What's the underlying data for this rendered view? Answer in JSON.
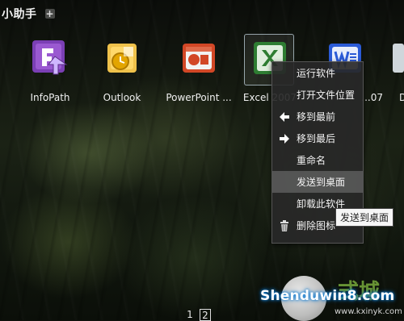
{
  "app": {
    "title": "小助手"
  },
  "tiles": [
    {
      "label": "InfoPath",
      "icon": "infopath-icon"
    },
    {
      "label": "Outlook",
      "icon": "outlook-icon"
    },
    {
      "label": "PowerPoint ...",
      "icon": "powerpoint-icon"
    },
    {
      "label": "Excel 2007",
      "icon": "excel-icon"
    },
    {
      "label": "...07",
      "icon": "word-icon"
    },
    {
      "label": "D",
      "icon": "partial-icon"
    }
  ],
  "context_menu": {
    "items": [
      {
        "label": "运行软件",
        "icon": ""
      },
      {
        "label": "打开文件位置",
        "icon": ""
      },
      {
        "label": "移到最前",
        "icon": "arrow-left-icon"
      },
      {
        "label": "移到最后",
        "icon": "arrow-right-icon"
      },
      {
        "label": "重命名",
        "icon": ""
      },
      {
        "label": "发送到桌面",
        "icon": ""
      },
      {
        "label": "卸载此软件",
        "icon": ""
      },
      {
        "label": "删除图标",
        "icon": "trash-icon"
      }
    ],
    "highlighted_index": 5
  },
  "tooltip": {
    "text": "发送到桌面"
  },
  "pager": {
    "pages": [
      "1",
      "2"
    ],
    "current": "2"
  },
  "watermark": {
    "main": "Shenduwin8.com",
    "url": "www.kxinyk.com",
    "chars": "式城"
  },
  "colors": {
    "infopath": "#7b3fb5",
    "outlook": "#e3a500",
    "powerpoint": "#d24726",
    "excel": "#2e7d32",
    "word": "#2b5bd7"
  }
}
